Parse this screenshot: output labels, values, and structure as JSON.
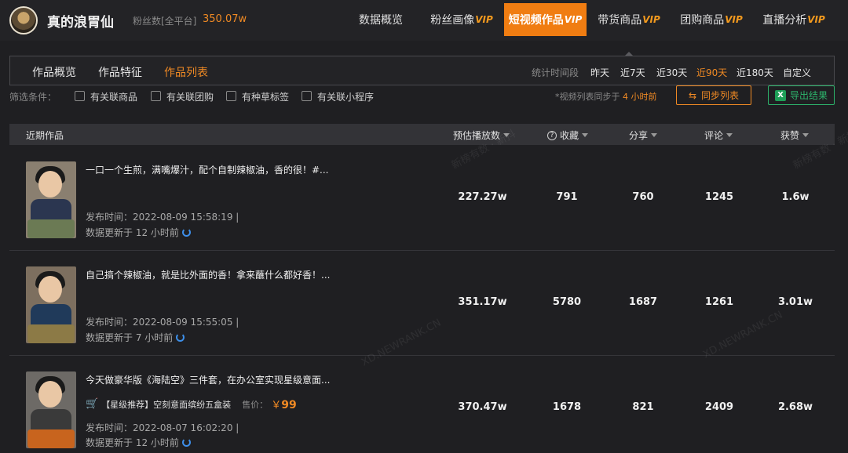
{
  "account": {
    "name": "真的浪胃仙",
    "fans_label": "粉丝数[全平台]",
    "fans_value": "350.07w"
  },
  "nav": [
    {
      "label": "数据概览",
      "vip": ""
    },
    {
      "label": "粉丝画像",
      "vip": "VIP"
    },
    {
      "label": "短视频作品",
      "vip": "VIP",
      "active": true
    },
    {
      "label": "带货商品",
      "vip": "VIP"
    },
    {
      "label": "团购商品",
      "vip": "VIP"
    },
    {
      "label": "直播分析",
      "vip": "VIP"
    }
  ],
  "subtabs": [
    "作品概览",
    "作品特征",
    "作品列表"
  ],
  "period": {
    "label": "统计时间段",
    "options": [
      "昨天",
      "近7天",
      "近30天",
      "近90天",
      "近180天",
      "自定义"
    ],
    "active": "近90天"
  },
  "filters": {
    "label": "筛选条件：",
    "options": [
      "有关联商品",
      "有关联团购",
      "有种草标签",
      "有关联小程序"
    ]
  },
  "sync": {
    "note_prefix": "*视频列表同步于",
    "note_value": "4 小时前",
    "button": "同步列表"
  },
  "export": {
    "icon": "X",
    "button": "导出结果"
  },
  "table": {
    "headers": {
      "work": "近期作品",
      "plays": "预估播放数",
      "favorites": "收藏",
      "shares": "分享",
      "comments": "评论",
      "likes": "获赞"
    },
    "rows": [
      {
        "title": "一口一个生煎，满嘴爆汁，配个自制辣椒油，香的很！#...",
        "publish": "发布时间：2022-08-09 15:58:19  |",
        "updated": "数据更新于 12 小时前",
        "plays": "227.27w",
        "favorites": "791",
        "shares": "760",
        "comments": "1245",
        "likes": "1.6w"
      },
      {
        "title": "自己搞个辣椒油，就是比外面的香！拿来蘸什么都好香！...",
        "publish": "发布时间：2022-08-09 15:55:05  |",
        "updated": "数据更新于 7 小时前",
        "plays": "351.17w",
        "favorites": "5780",
        "shares": "1687",
        "comments": "1261",
        "likes": "3.01w"
      },
      {
        "title": "今天做豪华版《海陆空》三件套，在办公室实现星级意面...",
        "product": {
          "name": "【星级推荐】空刻意面缤纷五盒装",
          "price_label": "售价：",
          "currency": "￥",
          "price": "99"
        },
        "publish": "发布时间：2022-08-07 16:02:20  |",
        "updated": "数据更新于 12 小时前",
        "plays": "370.47w",
        "favorites": "1678",
        "shares": "821",
        "comments": "2409",
        "likes": "2.68w"
      }
    ]
  },
  "watermarks": [
    "新榜有数 · 新抖",
    "新榜有数 · 新抖",
    "XD.NEWRANK.CN",
    "XD.NEWRANK.CN"
  ]
}
